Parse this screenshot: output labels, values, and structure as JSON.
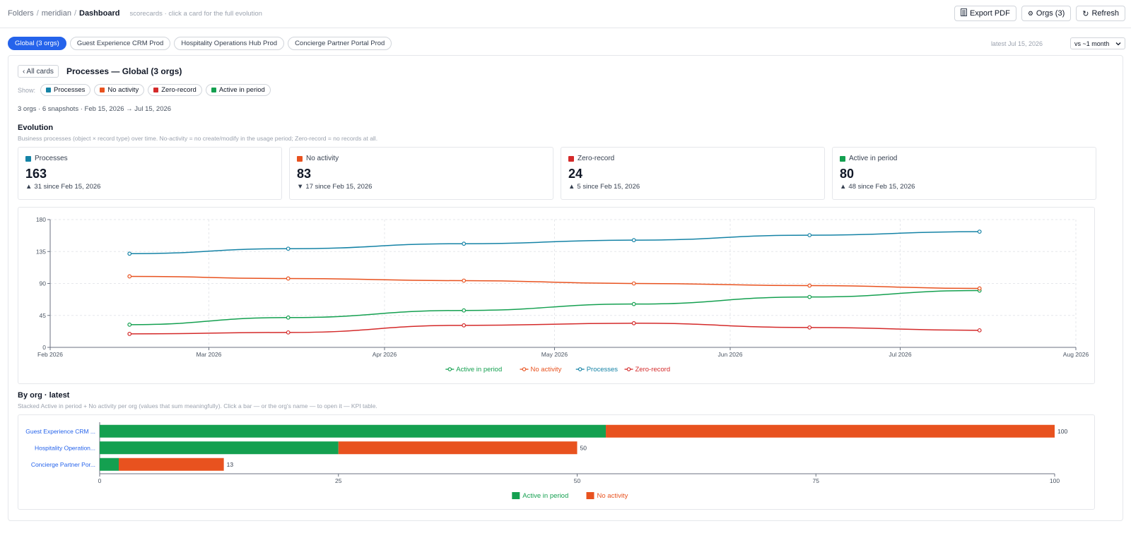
{
  "breadcrumb": {
    "folders": "Folders",
    "project": "meridian",
    "current": "Dashboard",
    "hint": "scorecards · click a card for the full evolution"
  },
  "toolbar": {
    "export_label": "Export PDF",
    "orgs_label": "Orgs (3)",
    "refresh_label": "Refresh"
  },
  "tabs": [
    {
      "label": "Global (3 orgs)",
      "active": true
    },
    {
      "label": "Guest Experience CRM Prod",
      "active": false
    },
    {
      "label": "Hospitality Operations Hub Prod",
      "active": false
    },
    {
      "label": "Concierge Partner Portal Prod",
      "active": false
    }
  ],
  "latest": "latest Jul 15, 2026",
  "compare": {
    "selected": "vs ~1 month"
  },
  "panel": {
    "back_label": "‹ All cards",
    "title": "Processes — Global (3 orgs)",
    "show_label": "Show:",
    "filters": [
      {
        "label": "Processes",
        "color": "#1583a6"
      },
      {
        "label": "No activity",
        "color": "#e8521f"
      },
      {
        "label": "Zero-record",
        "color": "#d42a2a"
      },
      {
        "label": "Active in period",
        "color": "#14a050"
      }
    ],
    "meta": "3 orgs · 6 snapshots · Feb 15, 2026 → Jul 15, 2026",
    "evolution_title": "Evolution",
    "evolution_sub": "Business processes (object × record type) over time. No-activity = no create/modify in the usage period; Zero-record = no records at all.",
    "byorg_title": "By org · latest",
    "byorg_sub": "Stacked Active in period + No activity per org (values that sum meaningfully). Click a bar — or the org's name — to open it — KPI table."
  },
  "kpis": [
    {
      "label": "Processes",
      "value": "163",
      "arrow": "▲",
      "delta": "31 since Feb 15, 2026",
      "color": "#1583a6"
    },
    {
      "label": "No activity",
      "value": "83",
      "arrow": "▼",
      "delta": "17 since Feb 15, 2026",
      "color": "#e8521f"
    },
    {
      "label": "Zero-record",
      "value": "24",
      "arrow": "▲",
      "delta": "5 since Feb 15, 2026",
      "color": "#d42a2a"
    },
    {
      "label": "Active in period",
      "value": "80",
      "arrow": "▲",
      "delta": "48 since Feb 15, 2026",
      "color": "#14a050"
    }
  ],
  "chart_data": [
    {
      "type": "line",
      "x": [
        "2026-02-15",
        "2026-03-15",
        "2026-04-15",
        "2026-05-15",
        "2026-06-15",
        "2026-07-15"
      ],
      "xlim": [
        "2026-02-01",
        "2026-08-01"
      ],
      "xticks": [
        "Feb 2026",
        "Mar 2026",
        "Apr 2026",
        "May 2026",
        "Jun 2026",
        "Jul 2026",
        "Aug 2026"
      ],
      "ylim": [
        0,
        180
      ],
      "yticks": [
        0,
        45,
        90,
        135,
        180
      ],
      "grid": true,
      "legend": "bottom",
      "series": [
        {
          "name": "Active in period",
          "color": "#14a050",
          "values": [
            32,
            42,
            52,
            61,
            71,
            80
          ]
        },
        {
          "name": "No activity",
          "color": "#e8521f",
          "values": [
            100,
            97,
            94,
            90,
            87,
            83
          ]
        },
        {
          "name": "Processes",
          "color": "#1583a6",
          "values": [
            132,
            139,
            146,
            151,
            158,
            163
          ]
        },
        {
          "name": "Zero-record",
          "color": "#d42a2a",
          "values": [
            19,
            21,
            31,
            34,
            28,
            24
          ]
        }
      ]
    },
    {
      "type": "bar",
      "orientation": "horizontal",
      "stacked": true,
      "categories": [
        "Guest Experience CRM ...",
        "Hospitality Operation...",
        "Concierge Partner Por..."
      ],
      "xlim": [
        0,
        100
      ],
      "xticks": [
        0,
        25,
        50,
        75,
        100
      ],
      "legend": "bottom",
      "series": [
        {
          "name": "Active in period",
          "color": "#14a050",
          "values": [
            53,
            25,
            2
          ]
        },
        {
          "name": "No activity",
          "color": "#e8521f",
          "values": [
            47,
            25,
            11
          ]
        }
      ],
      "totals": [
        100,
        50,
        13
      ]
    }
  ]
}
